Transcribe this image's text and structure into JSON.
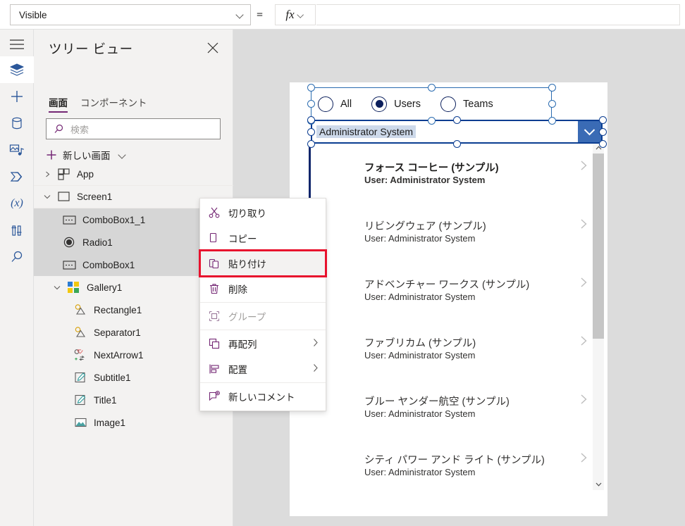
{
  "topbar": {
    "property_value": "Visible",
    "equals": "=",
    "fx_label": "fx",
    "formula_value": ""
  },
  "rail": {
    "items": [
      {
        "name": "hamburger-icon",
        "label": "メニュー"
      },
      {
        "name": "tree-view-icon",
        "label": "ツリー ビュー"
      },
      {
        "name": "insert-icon",
        "label": "挿入"
      },
      {
        "name": "data-icon",
        "label": "データ"
      },
      {
        "name": "media-icon",
        "label": "メディア"
      },
      {
        "name": "power-automate-icon",
        "label": "Power Automate"
      },
      {
        "name": "variables-icon",
        "label": "変数"
      },
      {
        "name": "app-checker-icon",
        "label": "アプリ チェッカー"
      },
      {
        "name": "search-icon",
        "label": "検索"
      }
    ]
  },
  "treeview": {
    "title": "ツリー ビュー",
    "close_label": "×",
    "tabs": [
      {
        "label": "画面",
        "selected": true
      },
      {
        "label": "コンポーネント",
        "selected": false
      }
    ],
    "search": {
      "placeholder": "検索",
      "value": ""
    },
    "new_screen": "新しい画面",
    "nodes": [
      {
        "label": "App",
        "indent": 0,
        "expander": "collapsed",
        "icon": "app-icon",
        "selected": false,
        "dots": false
      },
      {
        "label": "Screen1",
        "indent": 0,
        "expander": "expanded",
        "icon": "screen-icon",
        "selected": false,
        "dots": false
      },
      {
        "label": "ComboBox1_1",
        "indent": 1,
        "expander": "none",
        "icon": "combobox-icon",
        "selected": true,
        "dots": true
      },
      {
        "label": "Radio1",
        "indent": 1,
        "expander": "none",
        "icon": "radio-icon",
        "selected": true,
        "dots": false
      },
      {
        "label": "ComboBox1",
        "indent": 1,
        "expander": "none",
        "icon": "combobox-icon",
        "selected": true,
        "dots": false
      },
      {
        "label": "Gallery1",
        "indent": 1,
        "expander": "expanded",
        "icon": "gallery-icon",
        "selected": false,
        "dots": false
      },
      {
        "label": "Rectangle1",
        "indent": 2,
        "expander": "none",
        "icon": "shape-icon",
        "selected": false,
        "dots": false
      },
      {
        "label": "Separator1",
        "indent": 2,
        "expander": "none",
        "icon": "shape-icon",
        "selected": false,
        "dots": false
      },
      {
        "label": "NextArrow1",
        "indent": 2,
        "expander": "none",
        "icon": "nextarrow-icon",
        "selected": false,
        "dots": false
      },
      {
        "label": "Subtitle1",
        "indent": 2,
        "expander": "none",
        "icon": "label-icon",
        "selected": false,
        "dots": false
      },
      {
        "label": "Title1",
        "indent": 2,
        "expander": "none",
        "icon": "label-icon",
        "selected": false,
        "dots": false
      },
      {
        "label": "Image1",
        "indent": 2,
        "expander": "none",
        "icon": "image-icon",
        "selected": false,
        "dots": false
      }
    ],
    "dots_label": "•••"
  },
  "context_menu": {
    "items": [
      {
        "label": "切り取り",
        "icon": "cut-icon",
        "submenu": false,
        "disabled": false,
        "highlighted": false,
        "divider_after": false
      },
      {
        "label": "コピー",
        "icon": "copy-icon",
        "submenu": false,
        "disabled": false,
        "highlighted": false,
        "divider_after": false
      },
      {
        "label": "貼り付け",
        "icon": "paste-icon",
        "submenu": false,
        "disabled": false,
        "highlighted": true,
        "divider_after": false
      },
      {
        "label": "削除",
        "icon": "delete-icon",
        "submenu": false,
        "disabled": false,
        "highlighted": false,
        "divider_after": true
      },
      {
        "label": "グループ",
        "icon": "group-icon",
        "submenu": false,
        "disabled": true,
        "highlighted": false,
        "divider_after": true
      },
      {
        "label": "再配列",
        "icon": "reorder-icon",
        "submenu": true,
        "disabled": false,
        "highlighted": false,
        "divider_after": false
      },
      {
        "label": "配置",
        "icon": "align-icon",
        "submenu": true,
        "disabled": false,
        "highlighted": false,
        "divider_after": true
      },
      {
        "label": "新しいコメント",
        "icon": "comment-icon",
        "submenu": false,
        "disabled": false,
        "highlighted": false,
        "divider_after": false
      }
    ],
    "highlight_color": "#e8112d"
  },
  "canvas": {
    "radio": {
      "options": [
        {
          "label": "All",
          "checked": false
        },
        {
          "label": "Users",
          "checked": true
        },
        {
          "label": "Teams",
          "checked": false
        }
      ]
    },
    "combobox": {
      "value": "Administrator System"
    },
    "gallery": {
      "items": [
        {
          "title": "フォース コーヒー (サンプル)",
          "subtitle": "User: Administrator System"
        },
        {
          "title": "リビングウェア (サンプル)",
          "subtitle": "User: Administrator System"
        },
        {
          "title": "アドベンチャー ワークス (サンプル)",
          "subtitle": "User: Administrator System"
        },
        {
          "title": "ファブリカム (サンプル)",
          "subtitle": "User: Administrator System"
        },
        {
          "title": "ブルー ヤンダー航空 (サンプル)",
          "subtitle": "User: Administrator System"
        },
        {
          "title": "シティ パワー アンド ライト (サンプル)",
          "subtitle": "User: Administrator System"
        }
      ]
    }
  },
  "colors": {
    "accent_purple": "#742774",
    "selection_blue": "#2b6cb0",
    "combo_border": "#0b3d91",
    "highlight_red": "#e8112d"
  }
}
